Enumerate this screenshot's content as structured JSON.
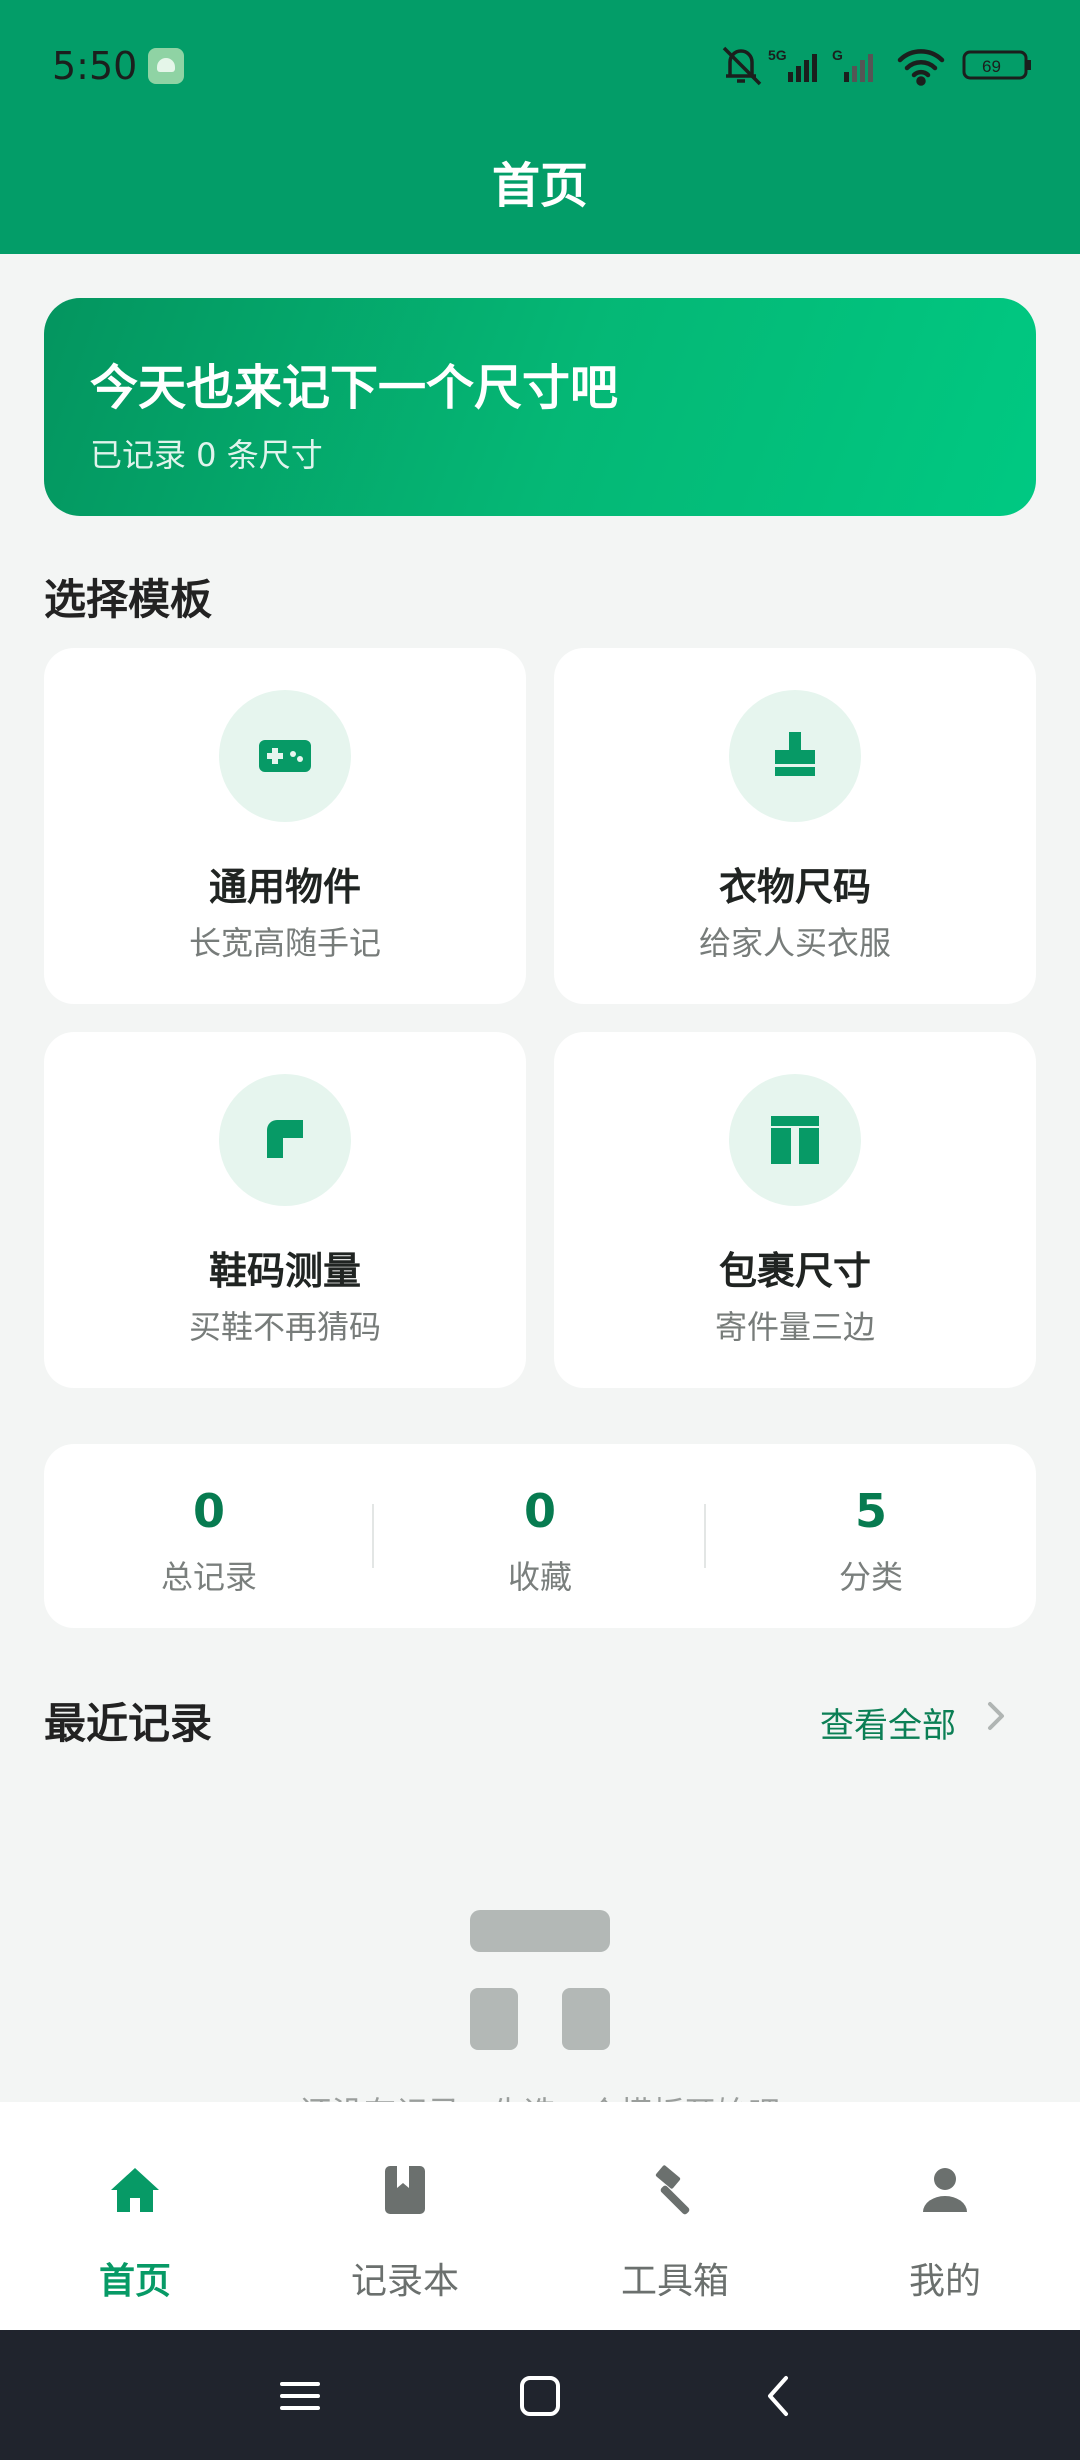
{
  "status_bar": {
    "time": "5:50",
    "battery": "69",
    "network_1": "5G",
    "network_2": "G",
    "icons": [
      "android-app-icon",
      "mute-bell-icon",
      "signal-icon",
      "signal-icon",
      "wifi-icon",
      "battery-icon"
    ]
  },
  "header": {
    "title": "首页",
    "background": "#039d68"
  },
  "banner": {
    "title": "今天也来记下一个尺寸吧",
    "subtitle": "已记录 0 条尺寸"
  },
  "templates_section": {
    "title": "选择模板"
  },
  "templates": [
    {
      "title": "通用物件",
      "subtitle": "长宽高随手记",
      "icon": "gamepad-icon"
    },
    {
      "title": "衣物尺码",
      "subtitle": "给家人买衣服",
      "icon": "shirt-icon"
    },
    {
      "title": "鞋码测量",
      "subtitle": "买鞋不再猜码",
      "icon": "shoe-icon"
    },
    {
      "title": "包裹尺寸",
      "subtitle": "寄件量三边",
      "icon": "package-icon"
    }
  ],
  "stats": [
    {
      "value": "0",
      "label": "总记录"
    },
    {
      "value": "0",
      "label": "收藏"
    },
    {
      "value": "5",
      "label": "分类"
    }
  ],
  "recent": {
    "title": "最近记录",
    "see_all": "查看全部",
    "empty_text": "还没有记录，先选一个模板开始吧"
  },
  "tabbar": [
    {
      "label": "首页",
      "icon": "home-icon",
      "active": true
    },
    {
      "label": "记录本",
      "icon": "notebook-icon",
      "active": false
    },
    {
      "label": "工具箱",
      "icon": "hammer-icon",
      "active": false
    },
    {
      "label": "我的",
      "icon": "person-icon",
      "active": false
    }
  ],
  "colors": {
    "accent": "#079a66",
    "accent_dark": "#077b50",
    "icon_bg": "#e6f5ee",
    "background": "#f3f5f4"
  }
}
